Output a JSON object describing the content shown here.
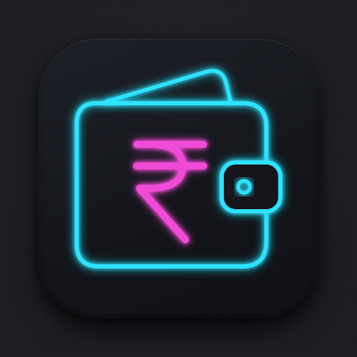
{
  "icon": {
    "name": "wallet-rupee-icon",
    "accent_color": "#2fe3ff",
    "glow_color": "#00c8ff",
    "symbol_color": "#f04bd6",
    "tile_color": "#16181d",
    "background_color": "#1b1c21"
  }
}
